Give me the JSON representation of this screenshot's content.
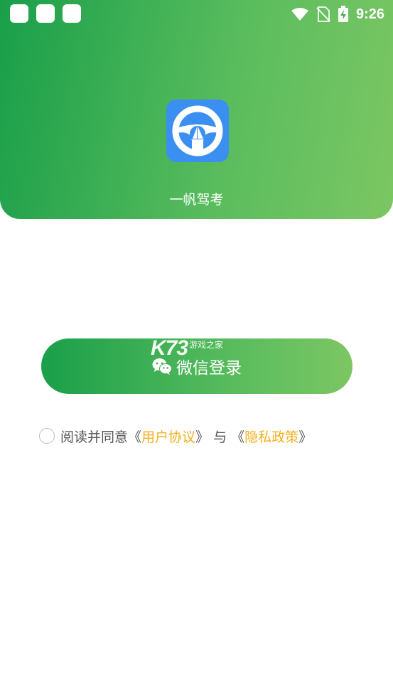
{
  "status_bar": {
    "time": "9:26",
    "icons": [
      "notification-square-icon",
      "notification-square-icon",
      "notification-square-icon",
      "wifi-icon",
      "no-sim-icon",
      "battery-charging-icon"
    ]
  },
  "header": {
    "app_name": "一帆驾考",
    "app_icon": "steering-wheel-sailboat-icon",
    "gradient_colors": [
      "#1a9f4a",
      "#7cc663"
    ]
  },
  "login": {
    "wechat_label": "微信登录",
    "wechat_icon": "wechat-icon"
  },
  "watermark": {
    "logo": "K73",
    "subtitle": "游戏之家"
  },
  "agreement": {
    "prefix": "阅读并同意",
    "open_quote_1": "《",
    "user_agreement": "用户协议",
    "close_quote_1": "》",
    "conjunction": " 与 ",
    "open_quote_2": "《",
    "privacy_policy": "隐私政策",
    "close_quote_2": "》",
    "link_color": "#f2b01e"
  }
}
